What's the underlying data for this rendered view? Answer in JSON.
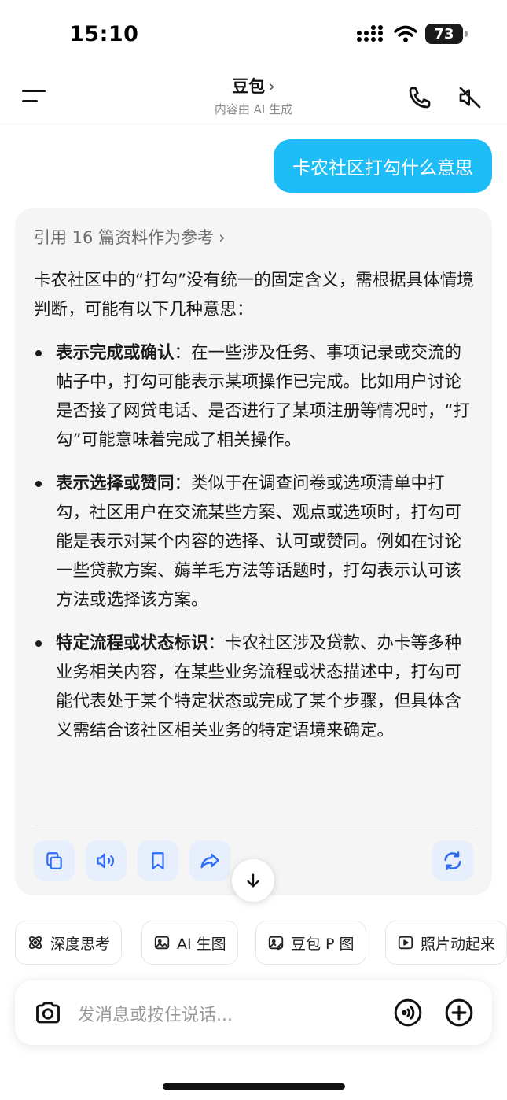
{
  "status_bar": {
    "time": "15:10",
    "battery": "73"
  },
  "header": {
    "title": "豆包",
    "chevron": "›",
    "subtitle": "内容由 AI 生成",
    "icons": [
      "menu-icon",
      "phone-icon",
      "speaker-muted-icon"
    ]
  },
  "user_message": "卡农社区打勾什么意思",
  "ai_message": {
    "references": "引用 16 篇资料作为参考",
    "references_chevron": "›",
    "intro": "卡农社区中的“打勾”没有统一的固定含义，需根据具体情境判断，可能有以下几种意思：",
    "bullets": [
      {
        "title": "表示完成或确认",
        "text": "：在一些涉及任务、事项记录或交流的帖子中，打勾可能表示某项操作已完成。比如用户讨论是否接了网贷电话、是否进行了某项注册等情况时，“打勾”可能意味着完成了相关操作。"
      },
      {
        "title": "表示选择或赞同",
        "text": "：类似于在调查问卷或选项清单中打勾，社区用户在交流某些方案、观点或选项时，打勾可能是表示对某个内容的选择、认可或赞同。例如在讨论一些贷款方案、薅羊毛方法等话题时，打勾表示认可该方法或选择该方案。"
      },
      {
        "title": "特定流程或状态标识",
        "text": "：卡农社区涉及贷款、办卡等多种业务相关内容，在某些业务流程或状态描述中，打勾可能代表处于某个特定状态或完成了某个步骤，但具体含义需结合该社区相关业务的特定语境来确定。"
      }
    ],
    "actions": [
      "copy-icon",
      "speaker-icon",
      "bookmark-icon",
      "share-icon",
      "refresh-icon"
    ]
  },
  "chips": [
    {
      "label": "深度思考",
      "icon": "atom-icon"
    },
    {
      "label": "AI 生图",
      "icon": "image-icon"
    },
    {
      "label": "豆包 P 图",
      "icon": "photo-edit-icon"
    },
    {
      "label": "照片动起来",
      "icon": "play-icon"
    }
  ],
  "input": {
    "placeholder": "发消息或按住说话..."
  },
  "colors": {
    "accent": "#1fbdf7",
    "action_bg": "#e7eefc",
    "action_icon": "#2f6cf6",
    "card_bg": "#f5f5f6"
  }
}
